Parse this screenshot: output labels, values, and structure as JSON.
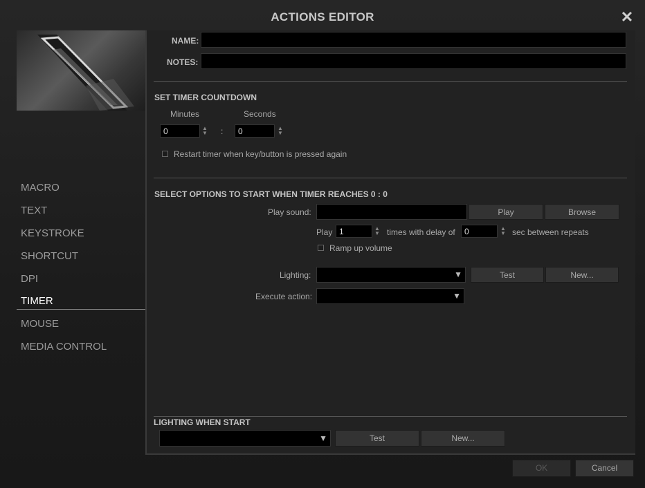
{
  "window": {
    "title": "ACTIONS EDITOR"
  },
  "sidebar": {
    "items": [
      {
        "label": "MACRO"
      },
      {
        "label": "TEXT"
      },
      {
        "label": "KEYSTROKE"
      },
      {
        "label": "SHORTCUT"
      },
      {
        "label": "DPI"
      },
      {
        "label": "TIMER",
        "active": true
      },
      {
        "label": "MOUSE"
      },
      {
        "label": "MEDIA CONTROL"
      }
    ]
  },
  "form": {
    "name_label": "NAME:",
    "name_value": "",
    "notes_label": "NOTES:",
    "notes_value": ""
  },
  "timer": {
    "heading": "SET TIMER COUNTDOWN",
    "minutes_label": "Minutes",
    "seconds_label": "Seconds",
    "minutes_value": "0",
    "seconds_value": "0",
    "separator": ":",
    "restart_label": "Restart timer when key/button is pressed again",
    "restart_checked": false
  },
  "options": {
    "heading": "SELECT OPTIONS TO START WHEN TIMER REACHES 0 : 0",
    "play_sound_label": "Play sound:",
    "play_sound_value": "",
    "play_button": "Play",
    "browse_button": "Browse",
    "play_label": "Play",
    "play_times_value": "1",
    "times_delay_label": "times with delay of",
    "delay_value": "0",
    "sec_label": "sec between repeats",
    "ramp_label": "Ramp up volume",
    "ramp_checked": false,
    "lighting_label": "Lighting:",
    "lighting_value": "",
    "lighting_test_button": "Test",
    "lighting_new_button": "New...",
    "execute_label": "Execute action:",
    "execute_value": ""
  },
  "lighting_start": {
    "heading": "LIGHTING WHEN START",
    "value": "",
    "test_button": "Test",
    "new_button": "New..."
  },
  "footer": {
    "ok_button": "OK",
    "cancel_button": "Cancel"
  },
  "icons": {
    "close": "close-icon",
    "spinner": "spinner-arrows-icon",
    "dropdown": "dropdown-arrow-icon"
  }
}
